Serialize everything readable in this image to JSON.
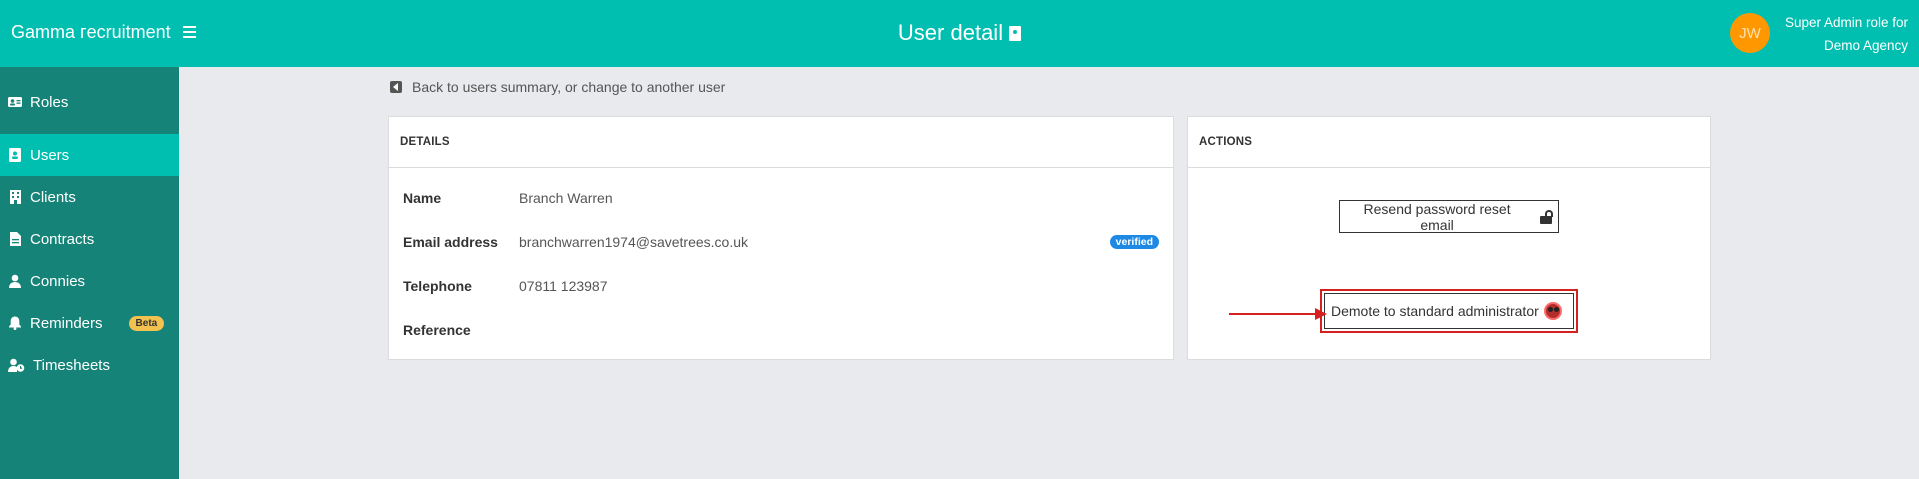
{
  "header": {
    "brand": "Gamma гecruitment",
    "title": "User detail",
    "avatar_initials": "JW",
    "role_line1": "Super Admin role for",
    "role_line2": "Demo Agency",
    "colors": {
      "bar": "#00bfb0",
      "avatar": "#ff9800"
    }
  },
  "sidebar": {
    "items": [
      {
        "label": "Roles",
        "icon": "id-card-icon"
      },
      {
        "label": "Users",
        "icon": "user-badge-icon",
        "active": true
      },
      {
        "label": "Clients",
        "icon": "building-icon"
      },
      {
        "label": "Contracts",
        "icon": "document-icon"
      },
      {
        "label": "Connies",
        "icon": "person-icon"
      },
      {
        "label": "Reminders",
        "icon": "bell-icon",
        "badge": "Beta"
      },
      {
        "label": "Timesheets",
        "icon": "user-clock-icon"
      }
    ]
  },
  "back_link": "Back to users summary, or change to another user",
  "details": {
    "heading": "DETAILS",
    "rows": [
      {
        "label": "Name",
        "value": "Branch Warren"
      },
      {
        "label": "Email address",
        "value": "branchwarren1974@savetrees.co.uk",
        "badge": "verified"
      },
      {
        "label": "Telephone",
        "value": "07811 123987"
      },
      {
        "label": "Reference",
        "value": ""
      }
    ]
  },
  "actions": {
    "heading": "ACTIONS",
    "resend_label": "Resend password reset email",
    "demote_label": "Demote to standard administrator"
  }
}
